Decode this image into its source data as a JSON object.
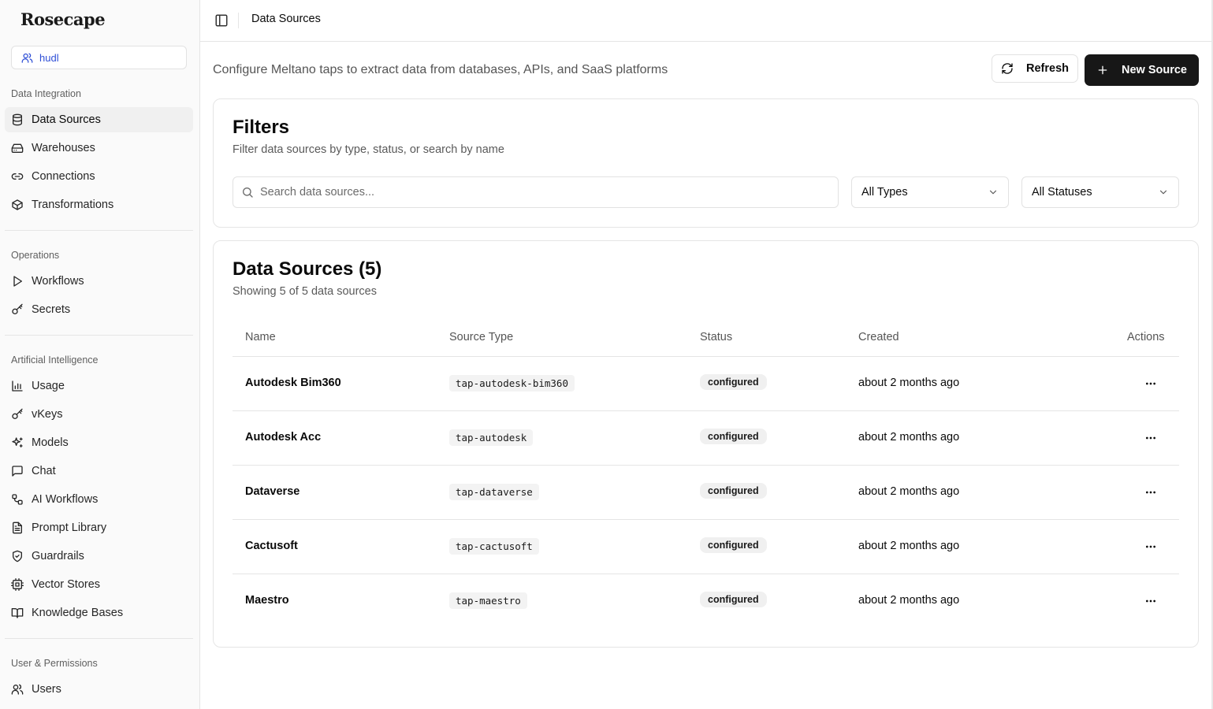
{
  "app": {
    "logo": "Rosecape"
  },
  "org": {
    "name": "hudl"
  },
  "sidebar": {
    "sections": [
      {
        "label": "Data Integration",
        "items": [
          {
            "label": "Data Sources",
            "icon": "database-icon",
            "active": true
          },
          {
            "label": "Warehouses",
            "icon": "hard-drive-icon"
          },
          {
            "label": "Connections",
            "icon": "link-icon"
          },
          {
            "label": "Transformations",
            "icon": "box-icon"
          }
        ]
      },
      {
        "label": "Operations",
        "items": [
          {
            "label": "Workflows",
            "icon": "play-icon"
          },
          {
            "label": "Secrets",
            "icon": "key-icon"
          }
        ]
      },
      {
        "label": "Artificial Intelligence",
        "items": [
          {
            "label": "Usage",
            "icon": "bar-chart-icon"
          },
          {
            "label": "vKeys",
            "icon": "key-icon"
          },
          {
            "label": "Models",
            "icon": "sparkles-icon"
          },
          {
            "label": "Chat",
            "icon": "message-square-icon"
          },
          {
            "label": "AI Workflows",
            "icon": "workflow-icon"
          },
          {
            "label": "Prompt Library",
            "icon": "file-text-icon"
          },
          {
            "label": "Guardrails",
            "icon": "shield-check-icon"
          },
          {
            "label": "Vector Stores",
            "icon": "cpu-icon"
          },
          {
            "label": "Knowledge Bases",
            "icon": "book-open-icon"
          }
        ]
      },
      {
        "label": "User & Permissions",
        "items": [
          {
            "label": "Users",
            "icon": "users-icon"
          }
        ]
      }
    ]
  },
  "topbar": {
    "breadcrumb": "Data Sources"
  },
  "header": {
    "subtitle": "Configure Meltano taps to extract data from databases, APIs, and SaaS platforms",
    "refresh_label": "Refresh",
    "new_label": "New Source"
  },
  "filters": {
    "title": "Filters",
    "description": "Filter data sources by type, status, or search by name",
    "search_placeholder": "Search data sources...",
    "type_select": "All Types",
    "status_select": "All Statuses"
  },
  "sources": {
    "title": "Data Sources (5)",
    "description": "Showing 5 of 5 data sources",
    "columns": [
      "Name",
      "Source Type",
      "Status",
      "Created",
      "Actions"
    ],
    "rows": [
      {
        "name": "Autodesk Bim360",
        "type": "tap-autodesk-bim360",
        "status": "configured",
        "created": "about 2 months ago"
      },
      {
        "name": "Autodesk Acc",
        "type": "tap-autodesk",
        "status": "configured",
        "created": "about 2 months ago"
      },
      {
        "name": "Dataverse",
        "type": "tap-dataverse",
        "status": "configured",
        "created": "about 2 months ago"
      },
      {
        "name": "Cactusoft",
        "type": "tap-cactusoft",
        "status": "configured",
        "created": "about 2 months ago"
      },
      {
        "name": "Maestro",
        "type": "tap-maestro",
        "status": "configured",
        "created": "about 2 months ago"
      }
    ]
  }
}
